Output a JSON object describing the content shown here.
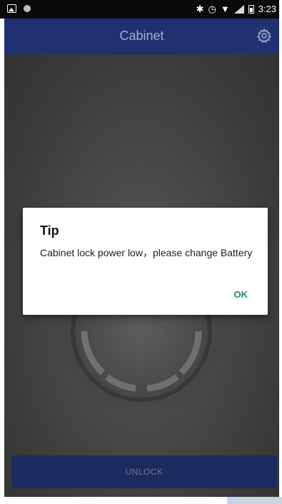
{
  "status_bar": {
    "time": "3:23",
    "left_icons": [
      "image-notification-icon",
      "circle-notification-icon"
    ],
    "right_icons": [
      "bluetooth-icon",
      "alarm-icon",
      "wifi-icon",
      "signal-icon",
      "battery-icon"
    ]
  },
  "app_bar": {
    "title": "Cabinet",
    "settings_icon": "gear-icon"
  },
  "main": {
    "unlock_label": "UNLOCK"
  },
  "dialog": {
    "title": "Tip",
    "message": "Cabinet lock power low，please change Battery",
    "ok_label": "OK"
  },
  "colors": {
    "app_bar": "#1f3170",
    "unlock_button": "#1c2b5d",
    "ok_text": "#1a8a86",
    "overlay_bg": "#3c3c3c"
  }
}
